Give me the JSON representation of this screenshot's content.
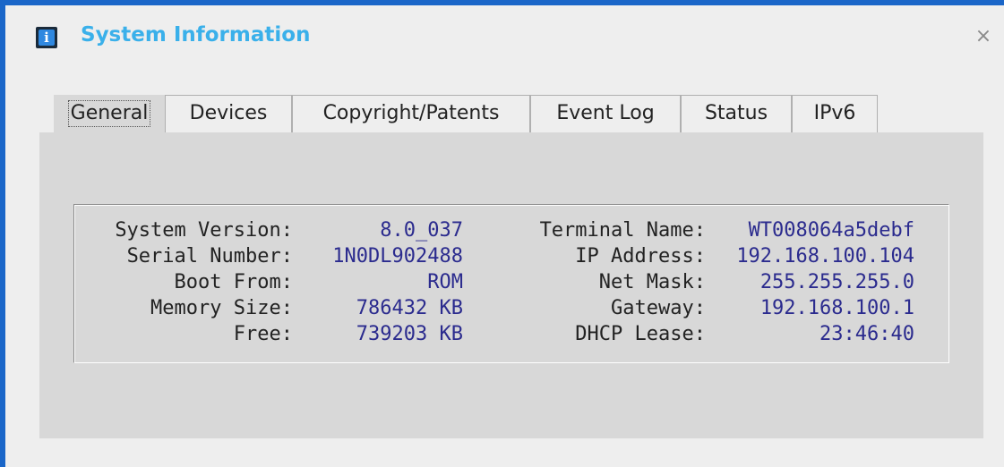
{
  "window": {
    "title": "System Information",
    "close_glyph": "×",
    "info_icon_glyph": "i",
    "accent_color": "#1a66c8",
    "title_color": "#3ab0ea"
  },
  "tabs": [
    {
      "label": "General",
      "active": true
    },
    {
      "label": "Devices",
      "active": false
    },
    {
      "label": "Copyright/Patents",
      "active": false
    },
    {
      "label": "Event Log",
      "active": false
    },
    {
      "label": "Status",
      "active": false
    },
    {
      "label": "IPv6",
      "active": false
    }
  ],
  "general": {
    "left": [
      {
        "label": "System Version:",
        "value": "8.0_037"
      },
      {
        "label": "Serial Number:",
        "value": "1N0DL902488"
      },
      {
        "label": "Boot From:",
        "value": "ROM"
      },
      {
        "label": "Memory Size:",
        "value": "786432 KB"
      },
      {
        "label": "Free:",
        "value": "739203 KB"
      }
    ],
    "right": [
      {
        "label": "Terminal Name:",
        "value": "WT008064a5debf"
      },
      {
        "label": "IP Address:",
        "value": "192.168.100.104"
      },
      {
        "label": "Net Mask:",
        "value": "255.255.255.0"
      },
      {
        "label": "Gateway:",
        "value": "192.168.100.1"
      },
      {
        "label": "DHCP Lease:",
        "value": "23:46:40"
      }
    ]
  }
}
